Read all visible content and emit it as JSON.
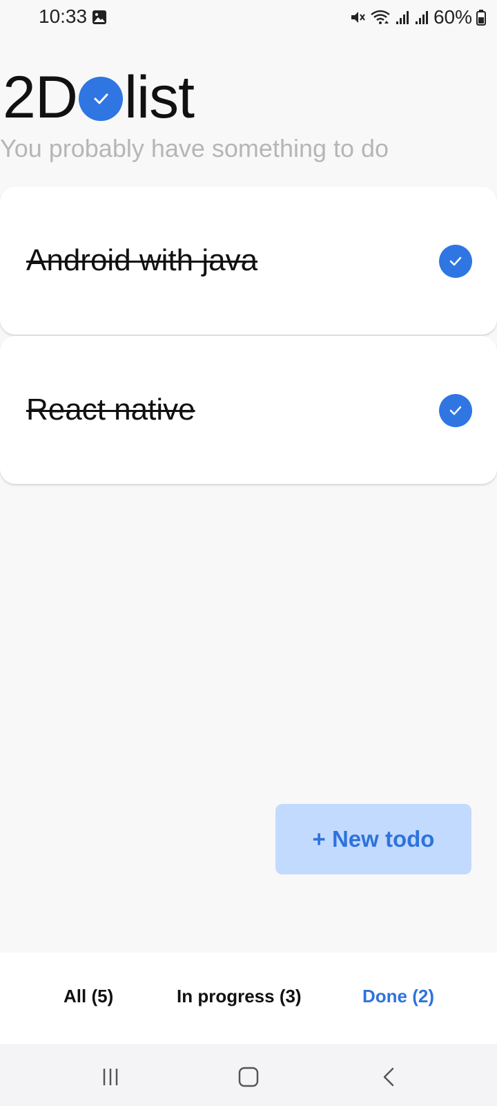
{
  "status_bar": {
    "time": "10:33",
    "battery": "60%",
    "icons": [
      "gallery-icon",
      "mute-icon",
      "wifi-icon",
      "signal-icon",
      "signal-icon",
      "battery-icon"
    ]
  },
  "header": {
    "logo_left": "2D",
    "logo_right": "list",
    "subtitle": "You probably have something to do"
  },
  "todos": [
    {
      "text": "Android with java",
      "done": true
    },
    {
      "text": "React native",
      "done": true
    }
  ],
  "new_todo_label": "+ New todo",
  "tabs": [
    {
      "label": "All (5)",
      "active": false
    },
    {
      "label": "In progress (3)",
      "active": false
    },
    {
      "label": "Done (2)",
      "active": true
    }
  ],
  "colors": {
    "accent": "#2f76e3",
    "button_bg": "#c3daff",
    "background": "#f8f8f9",
    "subtitle": "#b6b6b6"
  },
  "nav_bar": {
    "icons": [
      "recents-icon",
      "home-icon",
      "back-icon"
    ]
  }
}
